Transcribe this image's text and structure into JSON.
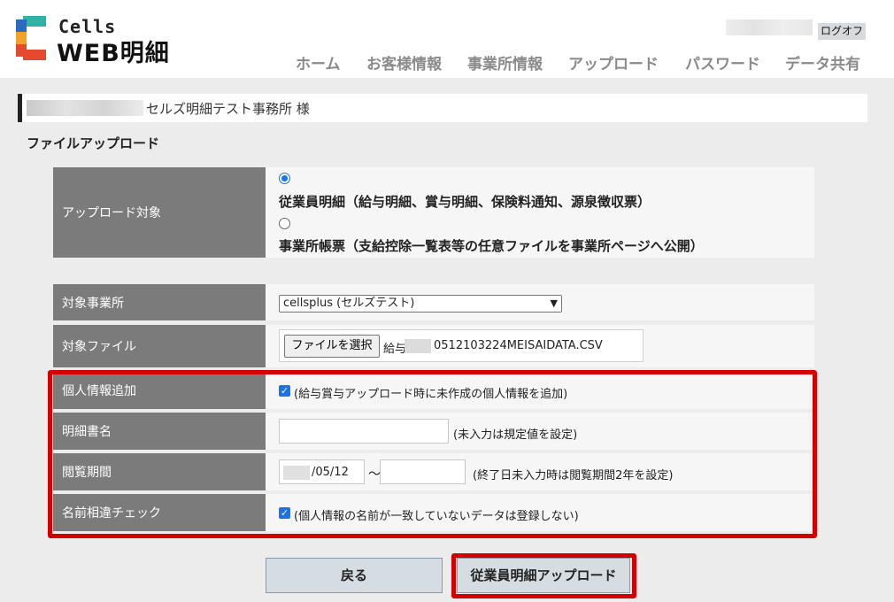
{
  "header": {
    "brand_top": "Cells",
    "brand_main": "WEB明細",
    "logout_label": "ログオフ",
    "nav": [
      "ホーム",
      "お客様情報",
      "事業所情報",
      "アップロード",
      "パスワード",
      "データ共有"
    ]
  },
  "office_bar": {
    "name": "セルズ明細テスト事務所 様"
  },
  "page_title": "ファイルアップロード",
  "form": {
    "upload_target": {
      "label": "アップロード対象",
      "options": [
        "従業員明細（給与明細、賞与明細、保険料通知、源泉徴収票）",
        "事業所帳票（支給控除一覧表等の任意ファイルを事業所ページへ公開）"
      ],
      "selected_index": 0
    },
    "office": {
      "label": "対象事業所",
      "selected": "cellsplus (セルズテスト)"
    },
    "file": {
      "label": "対象ファイル",
      "button": "ファイルを選択",
      "prefix": "給与",
      "filename": "0512103224MEISAIDATA.CSV"
    },
    "personal_info": {
      "label": "個人情報追加",
      "checked": true,
      "text": "(給与賞与アップロード時に未作成の個人情報を追加)"
    },
    "statement_name": {
      "label": "明細書名",
      "value": "",
      "hint": "(未入力は規定値を設定)"
    },
    "view_period": {
      "label": "閲覧期間",
      "start": "/05/12",
      "separator": "～",
      "end": "",
      "hint": "(終了日未入力時は閲覧期間2年を設定)"
    },
    "name_check": {
      "label": "名前相違チェック",
      "checked": true,
      "text": "(個人情報の名前が一致していないデータは登録しない)"
    }
  },
  "buttons": {
    "back": "戻る",
    "upload": "従業員明細アップロード"
  },
  "colors": {
    "highlight": "#d40000",
    "label_bg": "#7b7b7b",
    "accent": "#1a73e8"
  }
}
